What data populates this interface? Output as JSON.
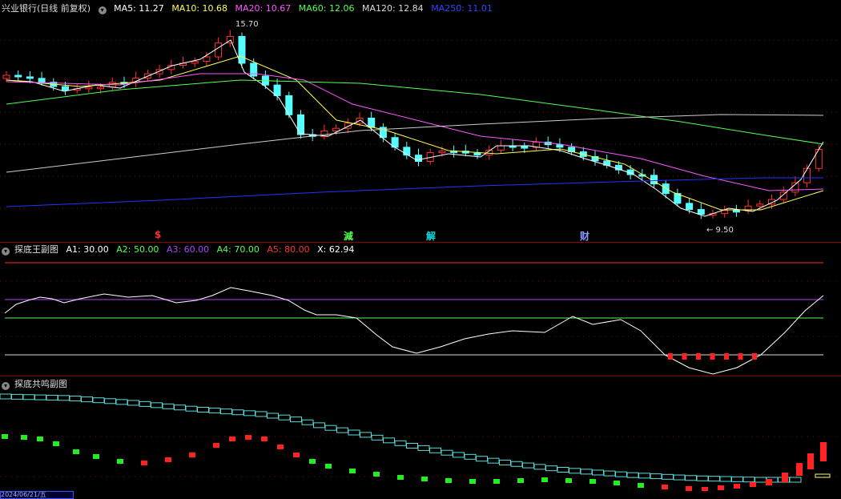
{
  "main": {
    "stock_name": "兴业银行",
    "period": "(日线 前复权)",
    "ma": [
      {
        "label": "MA5: 11.27",
        "color": "#ffffff"
      },
      {
        "label": "MA10: 10.68",
        "color": "#ffff55"
      },
      {
        "label": "MA20: 10.67",
        "color": "#ff55ff"
      },
      {
        "label": "MA60: 12.06",
        "color": "#55ff55"
      },
      {
        "label": "MA120: 12.84",
        "color": "#dddddd"
      },
      {
        "label": "MA250: 11.01",
        "color": "#3344ff"
      }
    ],
    "high_label": "15.70",
    "low_label": "9.50",
    "event_tags": [
      {
        "text": "$",
        "color": "#ff3333"
      },
      {
        "text": "減",
        "color": "#55ff55"
      },
      {
        "text": "解",
        "color": "#00dddd"
      },
      {
        "text": "财",
        "color": "#8899ff"
      }
    ]
  },
  "sub1": {
    "title": "探底王副图",
    "values": [
      {
        "label": "A1: 30.00",
        "color": "#ffffff"
      },
      {
        "label": "A2: 50.00",
        "color": "#55ff55"
      },
      {
        "label": "A3: 60.00",
        "color": "#aa44ff"
      },
      {
        "label": "A4: 70.00",
        "color": "#55ff55"
      },
      {
        "label": "A5: 80.00",
        "color": "#ff3333"
      },
      {
        "label": "X: 62.94",
        "color": "#ffffff"
      }
    ]
  },
  "sub2": {
    "title": "探底共鸣副图"
  },
  "footer": {
    "date_label": "2024/06/21/五"
  },
  "colors": {
    "up": "#ff3333",
    "down": "#55ffff",
    "grid": "#8b0000"
  }
}
